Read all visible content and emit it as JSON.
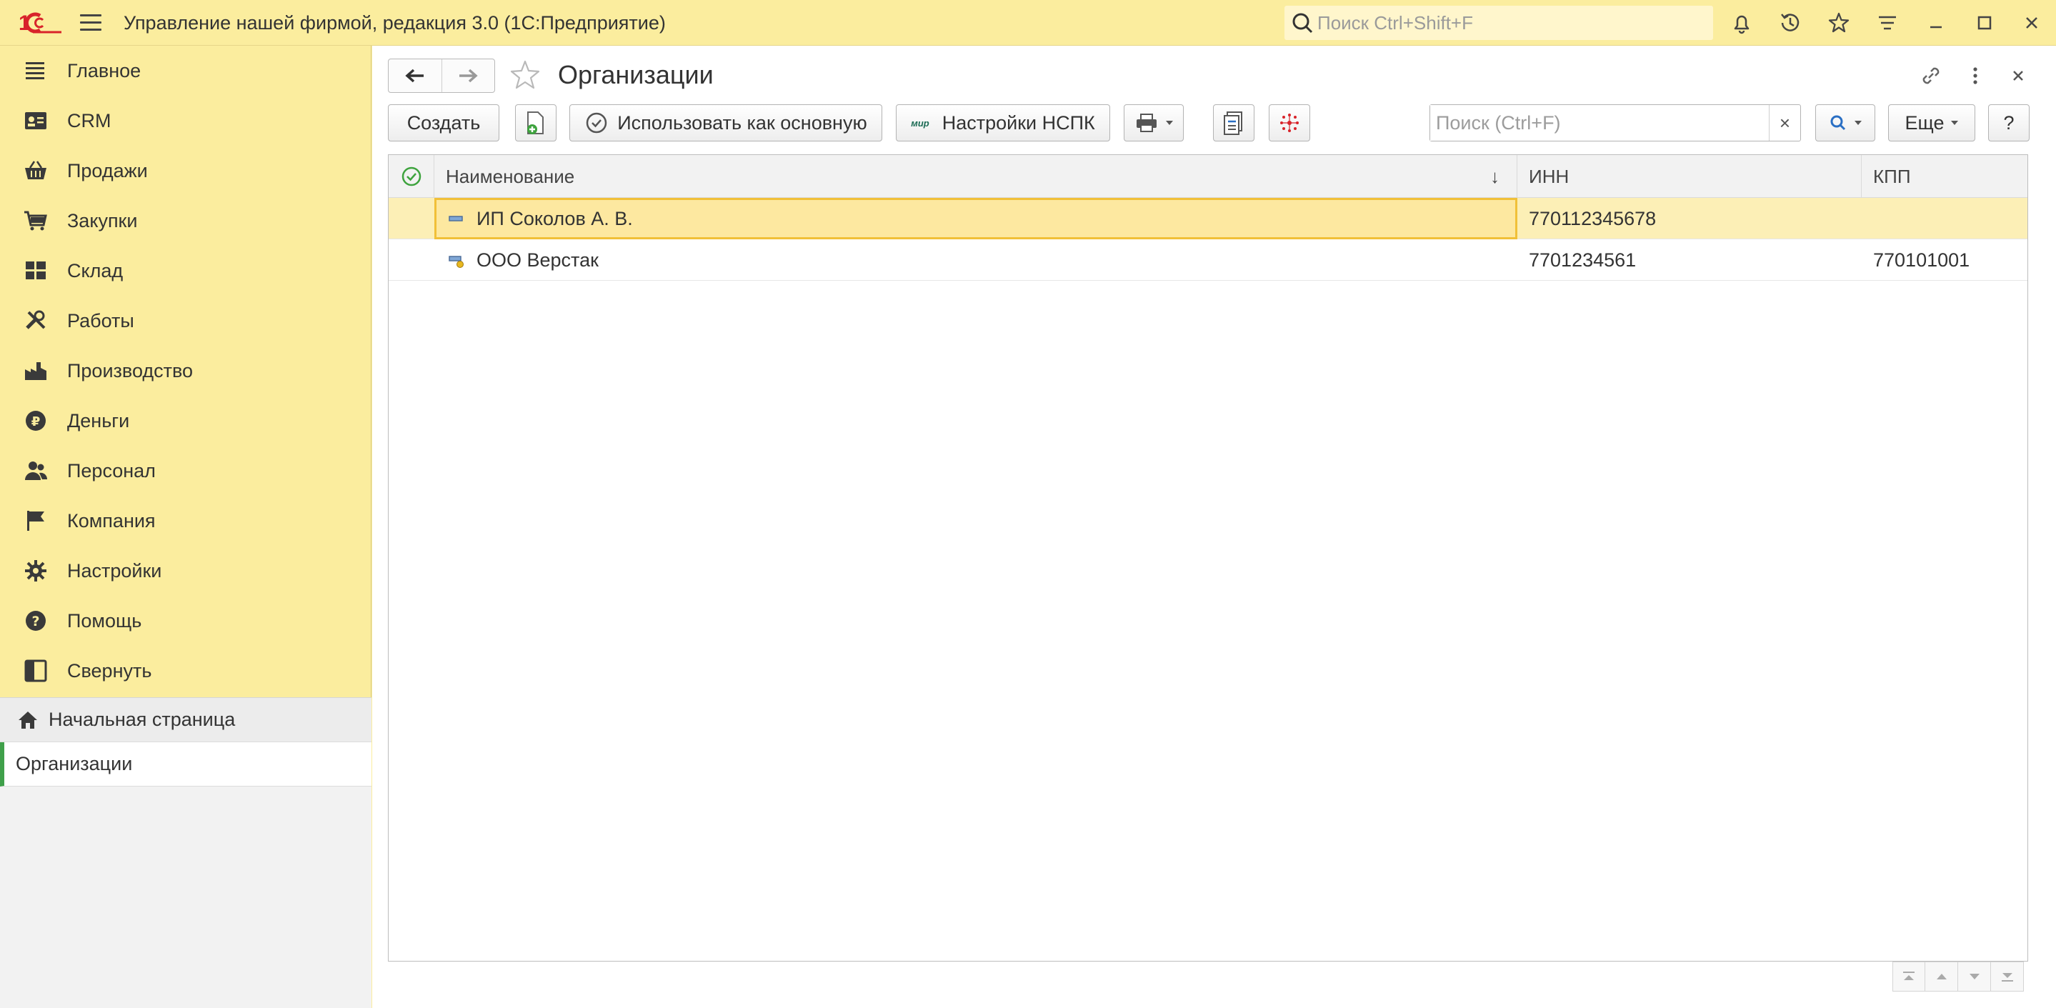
{
  "app": {
    "title": "Управление нашей фирмой, редакция 3.0  (1С:Предприятие)",
    "search_placeholder": "Поиск Ctrl+Shift+F",
    "logo_text": "1С"
  },
  "sidebar": {
    "items": [
      {
        "label": "Главное",
        "icon": "list-icon"
      },
      {
        "label": "CRM",
        "icon": "contact-card-icon"
      },
      {
        "label": "Продажи",
        "icon": "basket-icon"
      },
      {
        "label": "Закупки",
        "icon": "cart-icon"
      },
      {
        "label": "Склад",
        "icon": "warehouse-icon"
      },
      {
        "label": "Работы",
        "icon": "tools-icon"
      },
      {
        "label": "Производство",
        "icon": "factory-icon"
      },
      {
        "label": "Деньги",
        "icon": "ruble-icon"
      },
      {
        "label": "Персонал",
        "icon": "people-icon"
      },
      {
        "label": "Компания",
        "icon": "flag-icon"
      },
      {
        "label": "Настройки",
        "icon": "gear-icon"
      },
      {
        "label": "Помощь",
        "icon": "help-icon"
      },
      {
        "label": "Свернуть",
        "icon": "collapse-panel-icon"
      }
    ],
    "open_windows": {
      "home": "Начальная страница",
      "active": "Организации"
    }
  },
  "form": {
    "title": "Организации",
    "toolbar": {
      "create": "Создать",
      "use_as_main": "Использовать как основную",
      "nspk_settings": "Настройки НСПК",
      "mir_badge": "мир",
      "search_placeholder": "Поиск (Ctrl+F)",
      "search_clear": "×",
      "more": "Еще",
      "help": "?"
    },
    "table": {
      "columns": [
        "Наименование",
        "ИНН",
        "КПП"
      ],
      "sort_indicator": "↓",
      "rows": [
        {
          "name": "ИП Соколов А. В.",
          "inn": "770112345678",
          "kpp": "",
          "selected": true
        },
        {
          "name": "ООО Верстак",
          "inn": "7701234561",
          "kpp": "770101001",
          "selected": false,
          "is_main": true
        }
      ]
    }
  },
  "colors": {
    "panel_yellow": "#fbed9e",
    "selection": "#fcefb6",
    "selection_border": "#f1c038",
    "accent_green": "#3fa04a",
    "logo_red": "#d8232a"
  }
}
